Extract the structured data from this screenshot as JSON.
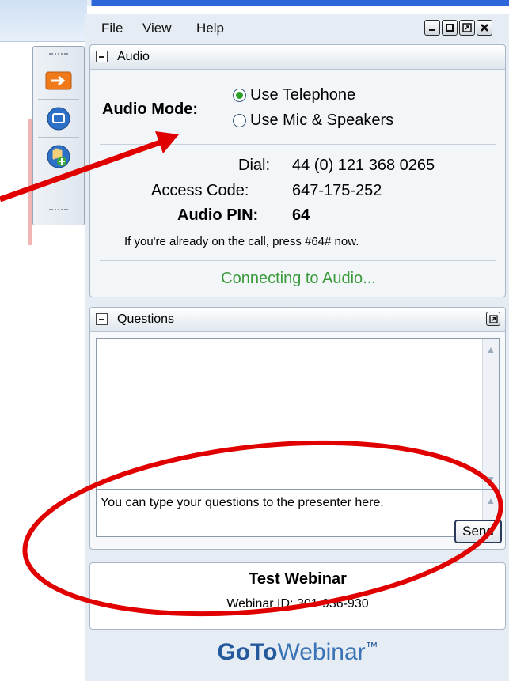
{
  "menu": {
    "file": "File",
    "view": "View",
    "help": "Help"
  },
  "window_controls": [
    "minimize-icon",
    "restore-icon",
    "popout-icon",
    "close-icon"
  ],
  "toolbar_icons": [
    "arrow-right-icon",
    "screen-icon",
    "raise-hand-icon"
  ],
  "audio": {
    "title": "Audio",
    "mode_label": "Audio Mode:",
    "option_telephone": "Use Telephone",
    "option_mic": "Use Mic & Speakers",
    "selected": "Use Telephone",
    "dial_label": "Dial:",
    "dial_value": "44 (0) 121 368 0265",
    "access_label": "Access Code:",
    "access_value": "647-175-252",
    "pin_label": "Audio PIN:",
    "pin_value": "64",
    "hint": "If you're already on the call, press #64# now.",
    "status": "Connecting to Audio..."
  },
  "questions": {
    "title": "Questions",
    "input_value": "You can type your questions to the presenter here.",
    "send_label": "Send"
  },
  "webinar": {
    "title": "Test Webinar",
    "id_line": "Webinar ID: 301-936-930"
  },
  "brand": {
    "bold": "GoTo",
    "light": "Webinar",
    "tm": "™"
  },
  "colors": {
    "accent": "#245a9c",
    "status_green": "#3a9a3a",
    "annotation_red": "#e00000"
  }
}
